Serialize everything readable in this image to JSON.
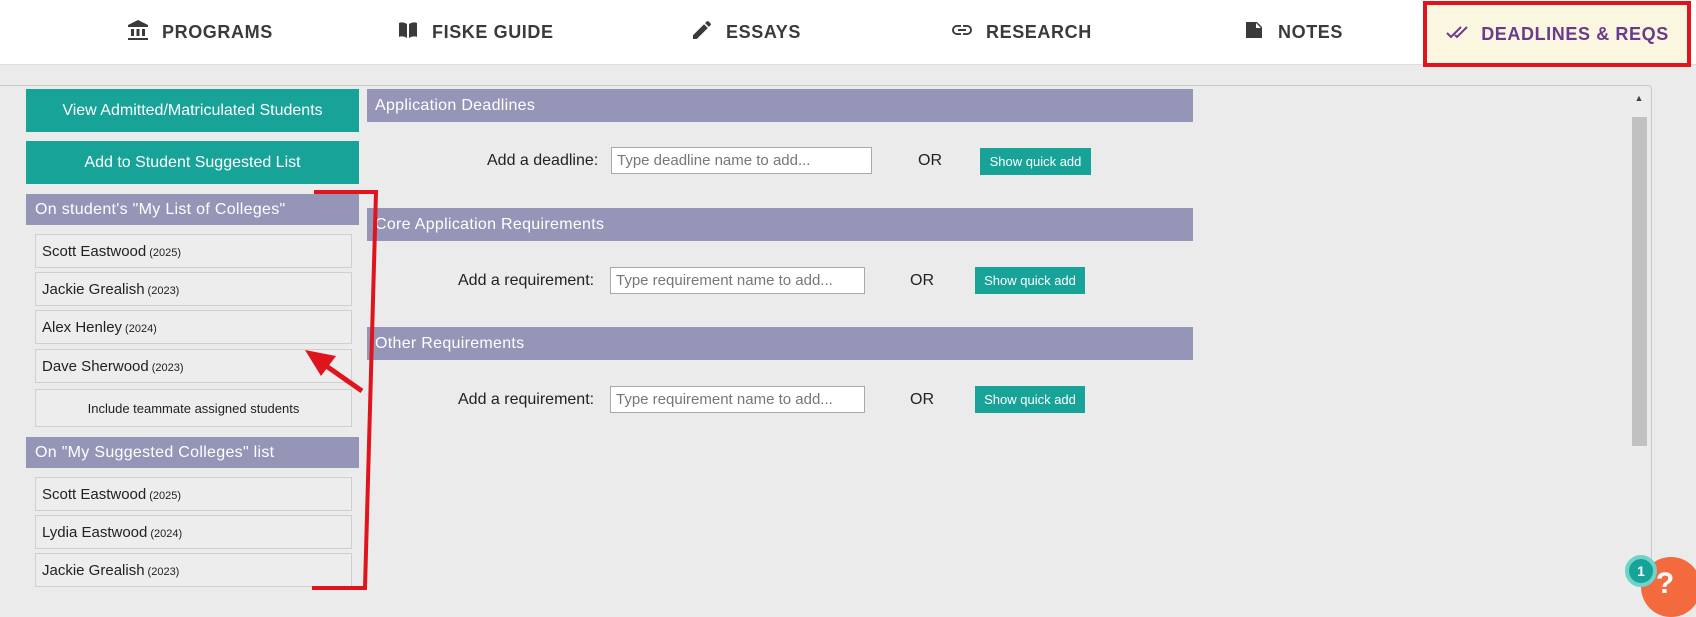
{
  "nav": {
    "tabs": [
      {
        "label": "PROGRAMS",
        "icon": "institution-icon"
      },
      {
        "label": "FISKE GUIDE",
        "icon": "book-icon"
      },
      {
        "label": "ESSAYS",
        "icon": "pencil-icon"
      },
      {
        "label": "RESEARCH",
        "icon": "link-icon"
      },
      {
        "label": "NOTES",
        "icon": "note-icon"
      },
      {
        "label": "DEADLINES & REQS",
        "icon": "double-check-icon",
        "active": true
      }
    ]
  },
  "sidebar": {
    "view_admitted_label": "View Admitted/Matriculated Students",
    "add_suggested_label": "Add to Student Suggested List",
    "my_list": {
      "heading": "On student's \"My List of Colleges\"",
      "students": [
        {
          "name": "Scott Eastwood",
          "year": "(2025)"
        },
        {
          "name": "Jackie Grealish",
          "year": "(2023)"
        },
        {
          "name": "Alex Henley",
          "year": "(2024)"
        },
        {
          "name": "Dave Sherwood",
          "year": "(2023)"
        }
      ],
      "include_teammate_label": "Include teammate assigned students"
    },
    "suggested_list": {
      "heading": "On \"My Suggested Colleges\" list",
      "students": [
        {
          "name": "Scott Eastwood",
          "year": "(2025)"
        },
        {
          "name": "Lydia Eastwood",
          "year": "(2024)"
        },
        {
          "name": "Jackie Grealish",
          "year": "(2023)"
        }
      ]
    }
  },
  "main": {
    "application_deadlines": {
      "heading": "Application Deadlines",
      "label": "Add a deadline:",
      "placeholder": "Type deadline name to add...",
      "or": "OR",
      "quick_add": "Show quick add"
    },
    "core_requirements": {
      "heading": "Core Application Requirements",
      "label": "Add a requirement:",
      "placeholder": "Type requirement name to add...",
      "or": "OR",
      "quick_add": "Show quick add"
    },
    "other_requirements": {
      "heading": "Other Requirements",
      "label": "Add a requirement:",
      "placeholder": "Type requirement name to add...",
      "or": "OR",
      "quick_add": "Show quick add"
    }
  },
  "widgets": {
    "notification_count": "1",
    "help_glyph": "?"
  },
  "colors": {
    "teal": "#17a398",
    "section_header": "#9595b8",
    "active_tab_bg": "#fbf6df",
    "active_tab_text": "#6a3b8c",
    "annotation_red": "#e0141c"
  }
}
